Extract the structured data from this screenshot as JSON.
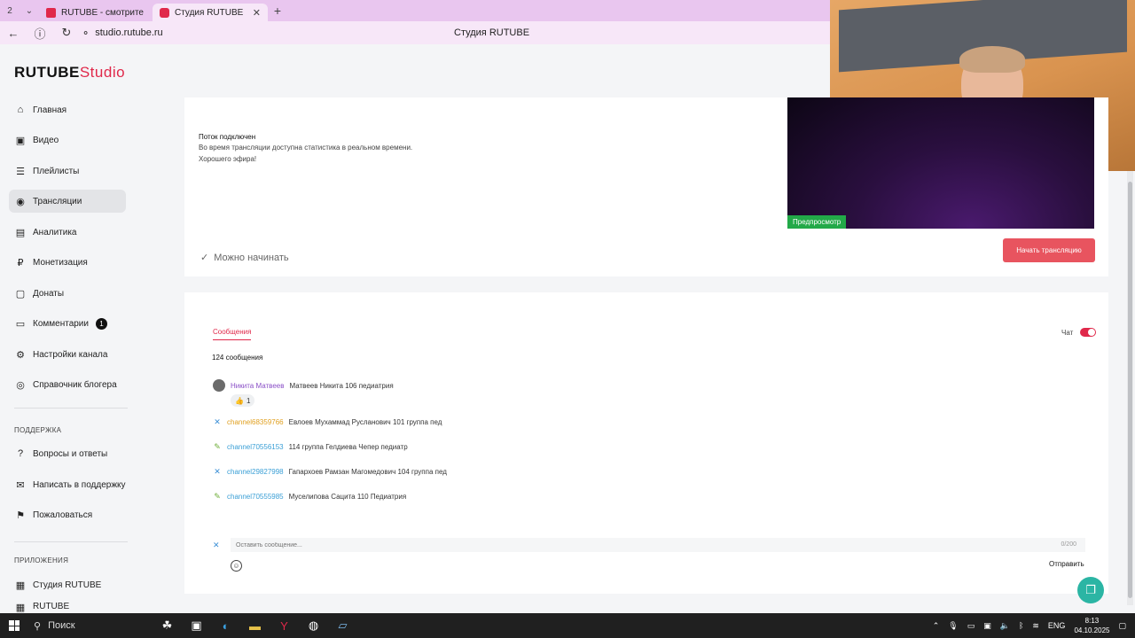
{
  "browser": {
    "tab_counter": "2",
    "tabs": [
      {
        "title": "RUTUBE - смотрите виде"
      },
      {
        "title": "Студия RUTUBE"
      }
    ],
    "new_tab": "+",
    "close_glyph": "✕",
    "url": "studio.rutube.ru",
    "page_title": "Студия RUTUBE"
  },
  "sidebar": {
    "logo_main": "RUTUBE",
    "logo_suffix": "Studio",
    "items": [
      {
        "label": "Главная",
        "icon": "home-icon"
      },
      {
        "label": "Видео",
        "icon": "video-icon"
      },
      {
        "label": "Плейлисты",
        "icon": "playlist-icon"
      },
      {
        "label": "Трансляции",
        "icon": "broadcast-icon"
      },
      {
        "label": "Аналитика",
        "icon": "analytics-icon"
      },
      {
        "label": "Монетизация",
        "icon": "monetization-icon"
      },
      {
        "label": "Донаты",
        "icon": "donate-icon"
      },
      {
        "label": "Комментарии",
        "icon": "comment-icon",
        "badge": "1"
      },
      {
        "label": "Настройки канала",
        "icon": "settings-icon"
      },
      {
        "label": "Справочник блогера",
        "icon": "guide-icon"
      }
    ],
    "support_section": "ПОДДЕРЖКА",
    "support_items": [
      {
        "label": "Вопросы и ответы",
        "icon": "faq-icon"
      },
      {
        "label": "Написать в поддержку",
        "icon": "mail-icon"
      },
      {
        "label": "Пожаловаться",
        "icon": "flag-icon"
      }
    ],
    "apps_section": "ПРИЛОЖЕНИЯ",
    "apps_items": [
      {
        "label": "Студия RUTUBE",
        "icon": "studio-app-icon"
      },
      {
        "label": "RUTUBE",
        "icon": "rutube-app-icon"
      }
    ]
  },
  "stream": {
    "title": "Поток подключен",
    "line1": "Во время трансляции доступна статистика в реальном времени.",
    "line2": "Хорошего эфира!",
    "status": "Можно начинать",
    "preview_label": "Предпросмотр",
    "start_button": "Начать трансляцию"
  },
  "chat": {
    "tab": "Сообщения",
    "count": "124 сообщения",
    "toggle_label": "Чат",
    "messages": [
      {
        "author": "Никита Матвеев",
        "text": "Матвеев Никита 106 педиатрия",
        "author_color": "#8a4fc7"
      },
      {
        "author": "channel68359766",
        "text": "Евлоев Мухаммад Русланович 101 группа пед",
        "author_color": "#e0a020"
      },
      {
        "author": "channel70556153",
        "text": "114 группа Гелдиева Чепер педиатр",
        "author_color": "#3a9fd6"
      },
      {
        "author": "channel29827998",
        "text": "Гапархоев Рамзан Магомедович 104 группа пед",
        "author_color": "#3a9fd6"
      },
      {
        "author": "channel70555985",
        "text": "Муселипова Сацита 110 Педиатрия",
        "author_color": "#3a9fd6"
      }
    ],
    "reaction_emoji": "👍",
    "reaction_count": "1",
    "input_placeholder": "Оставить сообщение...",
    "char_counter": "0/200",
    "send_button": "Отправить"
  },
  "taskbar": {
    "search": "Поиск",
    "lang": "ENG",
    "time": "8:13",
    "date": "04.10.2025"
  },
  "colors": {
    "accent": "#e0284a",
    "start_button": "#e8545f",
    "preview_tag": "#22a948",
    "float_button": "#2bb5a4"
  }
}
